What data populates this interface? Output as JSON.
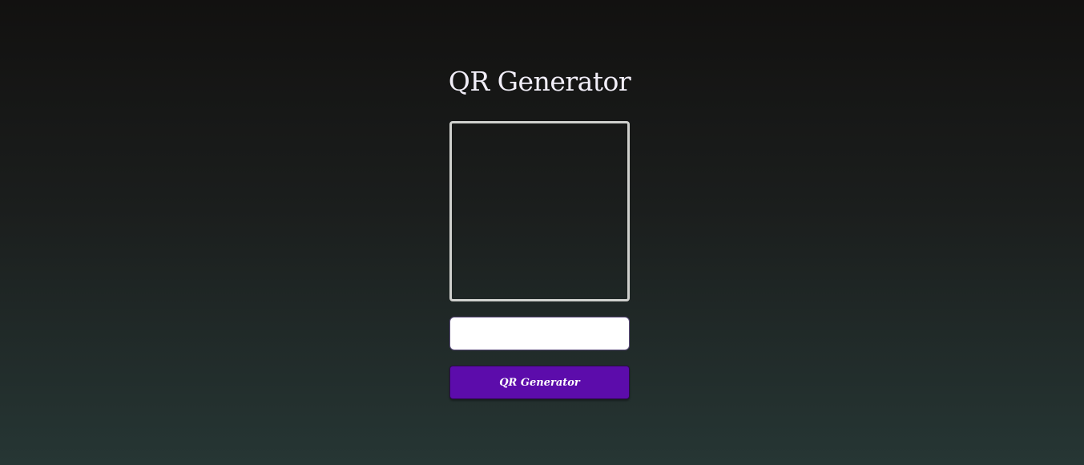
{
  "app": {
    "title": "QR Generator"
  },
  "input": {
    "value": "",
    "placeholder": ""
  },
  "button": {
    "label": "QR Generator"
  },
  "colors": {
    "background_top": "#121110",
    "background_bottom": "#263634",
    "title_text": "#f1eef8",
    "frame_border": "#cfd0cd",
    "button_bg": "#5c0cab",
    "button_text": "#ffffff"
  }
}
